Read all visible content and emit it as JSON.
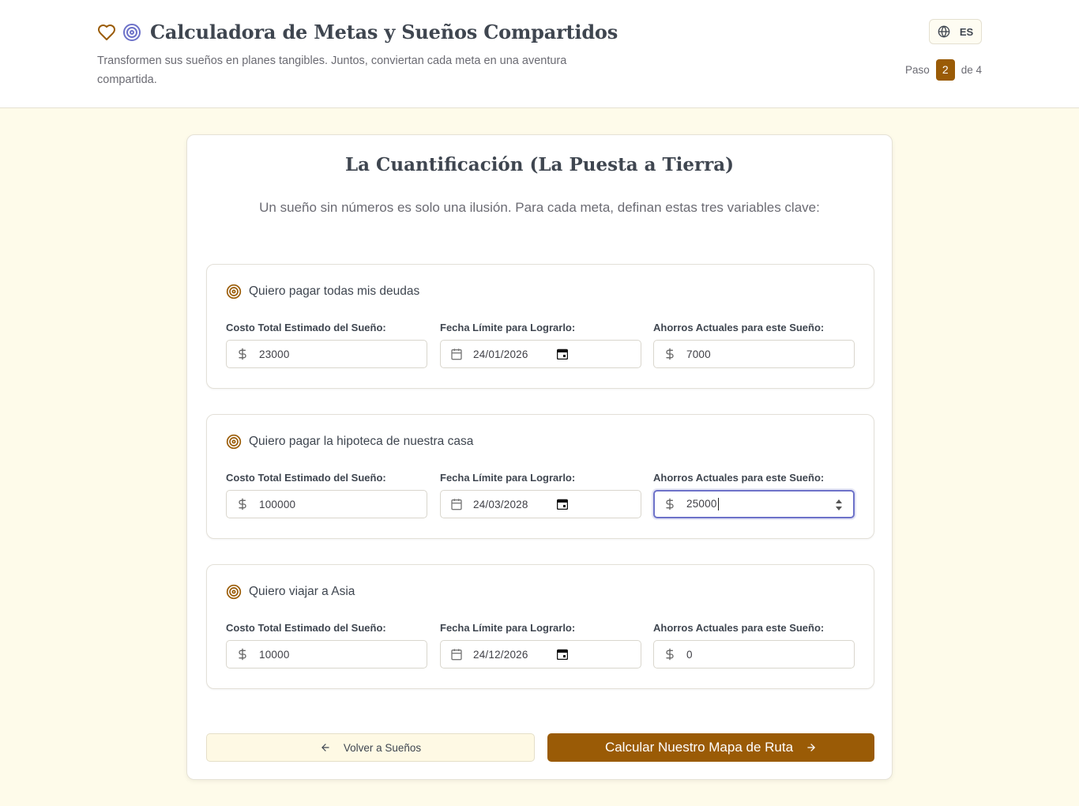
{
  "header": {
    "title": "Calculadora de Metas y Sueños Compartidos",
    "subtitle": "Transformen sus sueños en planes tangibles. Juntos, conviertan cada meta en una aventura compartida.",
    "language": "ES",
    "step_prefix": "Paso",
    "step_current": "2",
    "step_suffix": "de 4",
    "heart_icon": "heart-icon",
    "target_icon": "target-icon",
    "globe_icon": "globe-icon"
  },
  "section": {
    "title": "La Cuantificación (La Puesta a Tierra)",
    "description": "Un sueño sin números es solo una ilusión. Para cada meta, definan estas tres variables clave:"
  },
  "labels": {
    "cost": "Costo Total Estimado del Sueño:",
    "date": "Fecha Límite para Lograrlo:",
    "savings": "Ahorros Actuales para este Sueño:"
  },
  "goals": [
    {
      "title": "Quiero pagar todas mis deudas",
      "cost": "23000",
      "date": "24/01/2026",
      "savings": "7000"
    },
    {
      "title": "Quiero pagar la hipoteca de nuestra casa",
      "cost": "100000",
      "date": "24/03/2028",
      "savings": "25000"
    },
    {
      "title": "Quiero viajar a Asia",
      "cost": "10000",
      "date": "24/12/2026",
      "savings": "0"
    }
  ],
  "actions": {
    "back_label": "Volver a Sueños",
    "next_label": "Calcular Nuestro Mapa de Ruta"
  },
  "colors": {
    "accent": "#9a5b06",
    "background": "#fefbea",
    "focus": "#6d72c9",
    "target_secondary": "#6d72c9"
  }
}
